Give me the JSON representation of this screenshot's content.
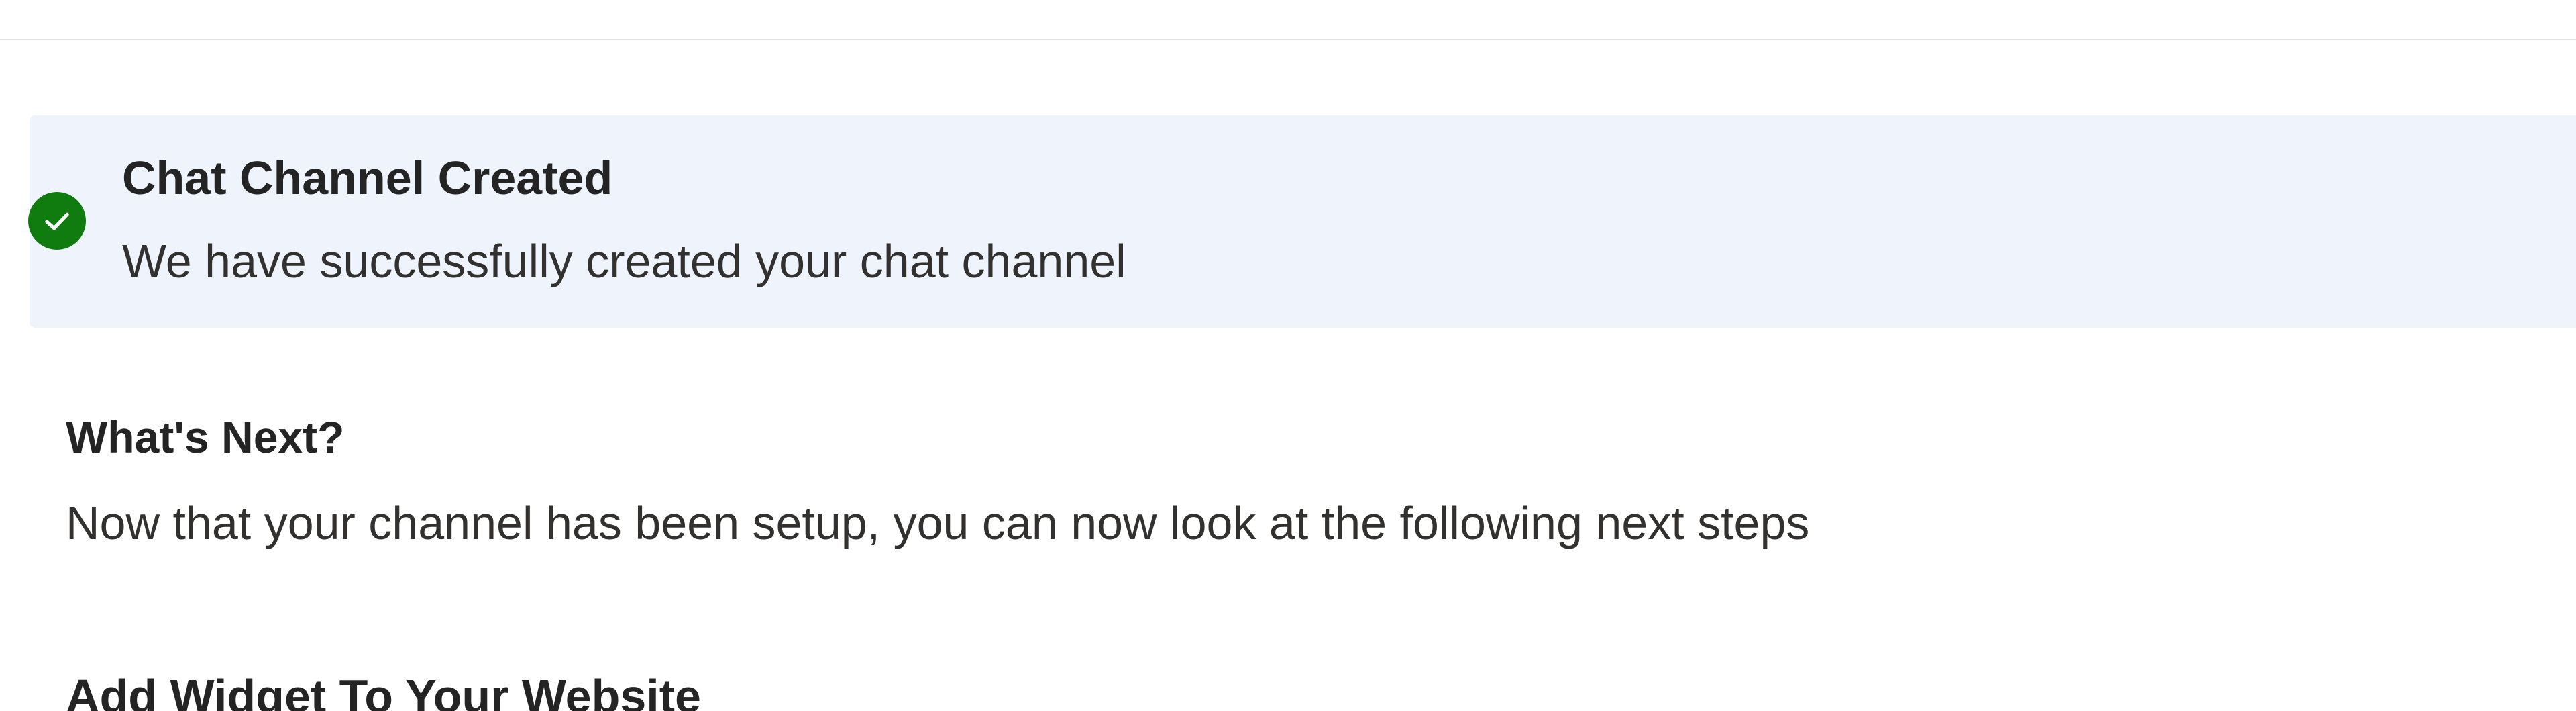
{
  "banner": {
    "title": "Chat Channel Created",
    "message": "We have successfully created your chat channel",
    "icon": "check-circle-icon",
    "icon_color": "#107C10",
    "background_color": "#EFF4FC"
  },
  "next_steps": {
    "title": "What's Next?",
    "description": "Now that your channel has been setup, you can now look at the following next steps"
  },
  "widget_section": {
    "heading": "Add Widget To Your Website"
  }
}
